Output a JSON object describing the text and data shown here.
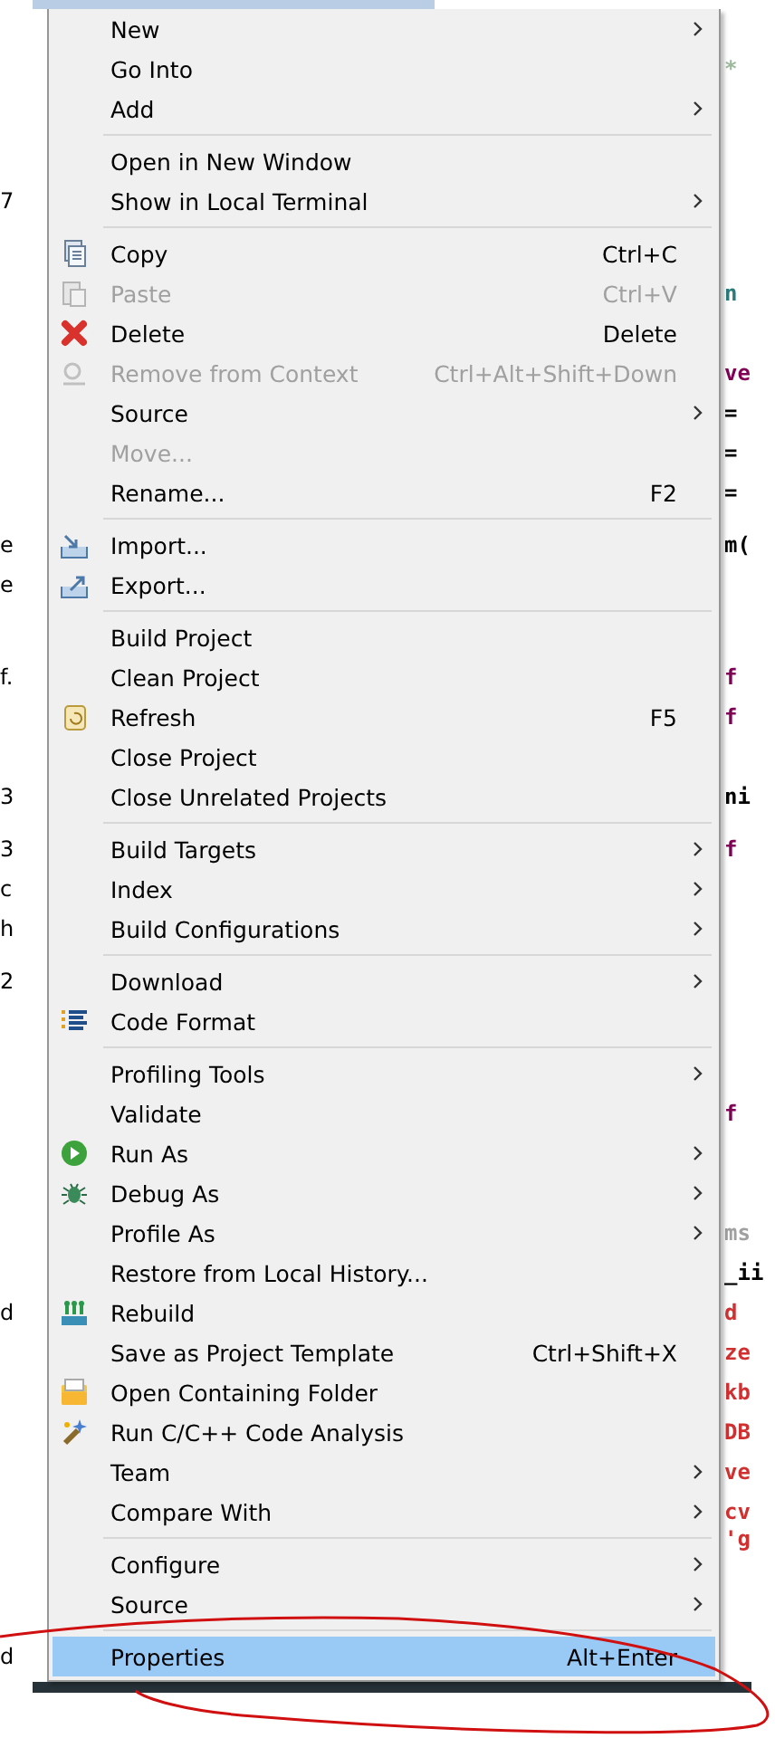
{
  "menu": {
    "items": [
      {
        "kind": "item",
        "label": "New",
        "submenu": true,
        "disabled": false,
        "selected": false,
        "icon": false
      },
      {
        "kind": "item",
        "label": "Go Into",
        "submenu": false,
        "disabled": false,
        "selected": false,
        "icon": false,
        "editor_fragment": {
          "text": "*",
          "color": "#9bb89b"
        }
      },
      {
        "kind": "item",
        "label": "Add",
        "submenu": true,
        "disabled": false,
        "selected": false,
        "icon": false
      },
      {
        "kind": "separator"
      },
      {
        "kind": "item",
        "label": "Open in New Window",
        "submenu": false,
        "disabled": false,
        "selected": false,
        "icon": false
      },
      {
        "kind": "item",
        "label": "Show in Local Terminal",
        "submenu": true,
        "disabled": false,
        "selected": false,
        "icon": false,
        "explorer_fragment": "7"
      },
      {
        "kind": "separator"
      },
      {
        "kind": "item",
        "label": "Copy",
        "shortcut": "Ctrl+C",
        "submenu": false,
        "disabled": false,
        "selected": false,
        "icon": true
      },
      {
        "kind": "item",
        "label": "Paste",
        "shortcut": "Ctrl+V",
        "submenu": false,
        "disabled": true,
        "selected": false,
        "icon": true,
        "editor_fragment": {
          "text": "n",
          "color": "#2a7a7a"
        }
      },
      {
        "kind": "item",
        "label": "Delete",
        "shortcut": "Delete",
        "submenu": false,
        "disabled": false,
        "selected": false,
        "icon": true
      },
      {
        "kind": "item",
        "label": "Remove from Context",
        "shortcut": "Ctrl+Alt+Shift+Down",
        "submenu": false,
        "disabled": true,
        "selected": false,
        "icon": true,
        "editor_fragment": {
          "text": "ve",
          "color": "#7f0055"
        }
      },
      {
        "kind": "item",
        "label": "Source",
        "submenu": true,
        "disabled": false,
        "selected": false,
        "icon": false,
        "editor_fragment": {
          "text": "=",
          "color": "#000000"
        }
      },
      {
        "kind": "item",
        "label": "Move...",
        "submenu": false,
        "disabled": true,
        "selected": false,
        "icon": false,
        "editor_fragment": {
          "text": "=",
          "color": "#000000"
        }
      },
      {
        "kind": "item",
        "label": "Rename...",
        "shortcut": "F2",
        "submenu": false,
        "disabled": false,
        "selected": false,
        "icon": false,
        "editor_fragment": {
          "text": "=",
          "color": "#000000"
        }
      },
      {
        "kind": "separator"
      },
      {
        "kind": "item",
        "label": "Import...",
        "submenu": false,
        "disabled": false,
        "selected": false,
        "icon": true,
        "explorer_fragment": "e",
        "editor_fragment": {
          "text": "m(",
          "color": "#000000"
        }
      },
      {
        "kind": "item",
        "label": "Export...",
        "submenu": false,
        "disabled": false,
        "selected": false,
        "icon": true,
        "explorer_fragment": "e"
      },
      {
        "kind": "separator"
      },
      {
        "kind": "item",
        "label": "Build Project",
        "submenu": false,
        "disabled": false,
        "selected": false,
        "icon": false
      },
      {
        "kind": "item",
        "label": "Clean Project",
        "submenu": false,
        "disabled": false,
        "selected": false,
        "icon": false,
        "explorer_fragment": "f.",
        "editor_fragment": {
          "text": "f",
          "color": "#7f0055"
        }
      },
      {
        "kind": "item",
        "label": "Refresh",
        "shortcut": "F5",
        "submenu": false,
        "disabled": false,
        "selected": false,
        "icon": true,
        "editor_fragment": {
          "text": "f",
          "color": "#7f0055"
        }
      },
      {
        "kind": "item",
        "label": "Close Project",
        "submenu": false,
        "disabled": false,
        "selected": false,
        "icon": false
      },
      {
        "kind": "item",
        "label": "Close Unrelated Projects",
        "submenu": false,
        "disabled": false,
        "selected": false,
        "icon": false,
        "explorer_fragment": "3",
        "editor_fragment": {
          "text": "ni",
          "color": "#000000"
        }
      },
      {
        "kind": "separator"
      },
      {
        "kind": "item",
        "label": "Build Targets",
        "submenu": true,
        "disabled": false,
        "selected": false,
        "icon": false,
        "explorer_fragment": "3",
        "editor_fragment": {
          "text": "f",
          "color": "#7f0055"
        }
      },
      {
        "kind": "item",
        "label": "Index",
        "submenu": true,
        "disabled": false,
        "selected": false,
        "icon": false,
        "explorer_fragment": "c"
      },
      {
        "kind": "item",
        "label": "Build Configurations",
        "submenu": true,
        "disabled": false,
        "selected": false,
        "icon": false,
        "explorer_fragment": "h"
      },
      {
        "kind": "separator"
      },
      {
        "kind": "item",
        "label": "Download",
        "submenu": true,
        "disabled": false,
        "selected": false,
        "icon": false,
        "explorer_fragment": "2"
      },
      {
        "kind": "item",
        "label": "Code Format",
        "submenu": false,
        "disabled": false,
        "selected": false,
        "icon": true
      },
      {
        "kind": "separator"
      },
      {
        "kind": "item",
        "label": "Profiling Tools",
        "submenu": true,
        "disabled": false,
        "selected": false,
        "icon": false
      },
      {
        "kind": "item",
        "label": "Validate",
        "submenu": false,
        "disabled": false,
        "selected": false,
        "icon": false,
        "editor_fragment": {
          "text": "f",
          "color": "#7f0055"
        }
      },
      {
        "kind": "item",
        "label": "Run As",
        "submenu": true,
        "disabled": false,
        "selected": false,
        "icon": true
      },
      {
        "kind": "item",
        "label": "Debug As",
        "submenu": true,
        "disabled": false,
        "selected": false,
        "icon": true
      },
      {
        "kind": "item",
        "label": "Profile As",
        "submenu": true,
        "disabled": false,
        "selected": false,
        "icon": false,
        "editor_fragment": {
          "text": "ms",
          "color": "#a0a0a0"
        }
      },
      {
        "kind": "item",
        "label": "Restore from Local History...",
        "submenu": false,
        "disabled": false,
        "selected": false,
        "icon": false,
        "editor_fragment": {
          "text": "_ii",
          "color": "#000000"
        }
      },
      {
        "kind": "item",
        "label": "Rebuild",
        "submenu": false,
        "disabled": false,
        "selected": false,
        "icon": true,
        "explorer_fragment": "d",
        "editor_fragment": {
          "text": "d",
          "color": "#d03030"
        }
      },
      {
        "kind": "item",
        "label": "Save as Project Template",
        "shortcut": "Ctrl+Shift+X",
        "submenu": false,
        "disabled": false,
        "selected": false,
        "icon": false,
        "editor_fragment": {
          "text": "ze",
          "color": "#d03030"
        }
      },
      {
        "kind": "item",
        "label": "Open Containing Folder",
        "submenu": false,
        "disabled": false,
        "selected": false,
        "icon": true,
        "editor_fragment": {
          "text": "kb",
          "color": "#d03030"
        }
      },
      {
        "kind": "item",
        "label": "Run C/C++ Code Analysis",
        "submenu": false,
        "disabled": false,
        "selected": false,
        "icon": true,
        "editor_fragment": {
          "text": "DB",
          "color": "#d03030"
        }
      },
      {
        "kind": "item",
        "label": "Team",
        "submenu": true,
        "disabled": false,
        "selected": false,
        "icon": false,
        "editor_fragment": {
          "text": "ve",
          "color": "#d03030"
        }
      },
      {
        "kind": "item",
        "label": "Compare With",
        "submenu": true,
        "disabled": false,
        "selected": false,
        "icon": false,
        "editor_fragment": {
          "text": "cv",
          "color": "#d03030"
        }
      },
      {
        "kind": "separator",
        "editor_fragment": {
          "text": "'g",
          "color": "#d03030"
        }
      },
      {
        "kind": "item",
        "label": "Configure",
        "submenu": true,
        "disabled": false,
        "selected": false,
        "icon": false
      },
      {
        "kind": "item",
        "label": "Source",
        "submenu": true,
        "disabled": false,
        "selected": false,
        "icon": false
      },
      {
        "kind": "separator"
      },
      {
        "kind": "item",
        "label": "Properties",
        "shortcut": "Alt+Enter",
        "submenu": false,
        "disabled": false,
        "selected": true,
        "icon": false,
        "explorer_fragment": "d"
      }
    ]
  }
}
